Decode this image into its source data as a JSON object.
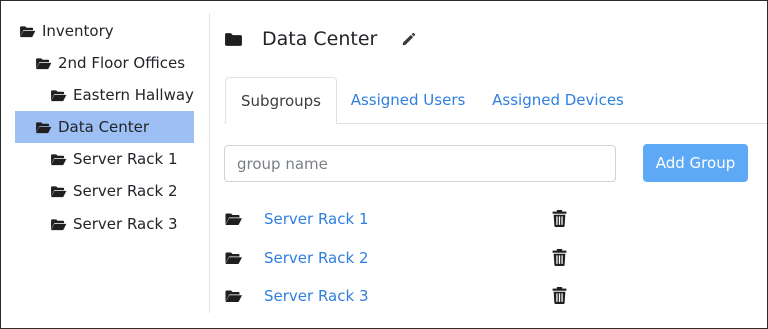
{
  "tree": {
    "items": [
      {
        "label": "Inventory",
        "selected": false
      },
      {
        "label": "2nd Floor Offices",
        "selected": false
      },
      {
        "label": "Eastern Hallway",
        "selected": false
      },
      {
        "label": "Data Center",
        "selected": true
      },
      {
        "label": "Server Rack 1",
        "selected": false
      },
      {
        "label": "Server Rack 2",
        "selected": false
      },
      {
        "label": "Server Rack 3",
        "selected": false
      }
    ],
    "selected_color": "#9dbff3"
  },
  "header": {
    "title": "Data Center",
    "folder_icon": "folder-icon",
    "edit_icon": "pencil-icon"
  },
  "tabs": {
    "items": [
      {
        "label": "Subgroups",
        "active": true
      },
      {
        "label": "Assigned Users",
        "active": false
      },
      {
        "label": "Assigned Devices",
        "active": false
      }
    ],
    "link_color": "#2f7fe0"
  },
  "add_group": {
    "input_value": "",
    "input_placeholder": "group name",
    "button_label": "Add Group",
    "button_color": "#5ea9f5"
  },
  "subgroups": {
    "items": [
      {
        "label": "Server Rack 1"
      },
      {
        "label": "Server Rack 2"
      },
      {
        "label": "Server Rack 3"
      }
    ],
    "delete_icon": "trash-icon"
  }
}
